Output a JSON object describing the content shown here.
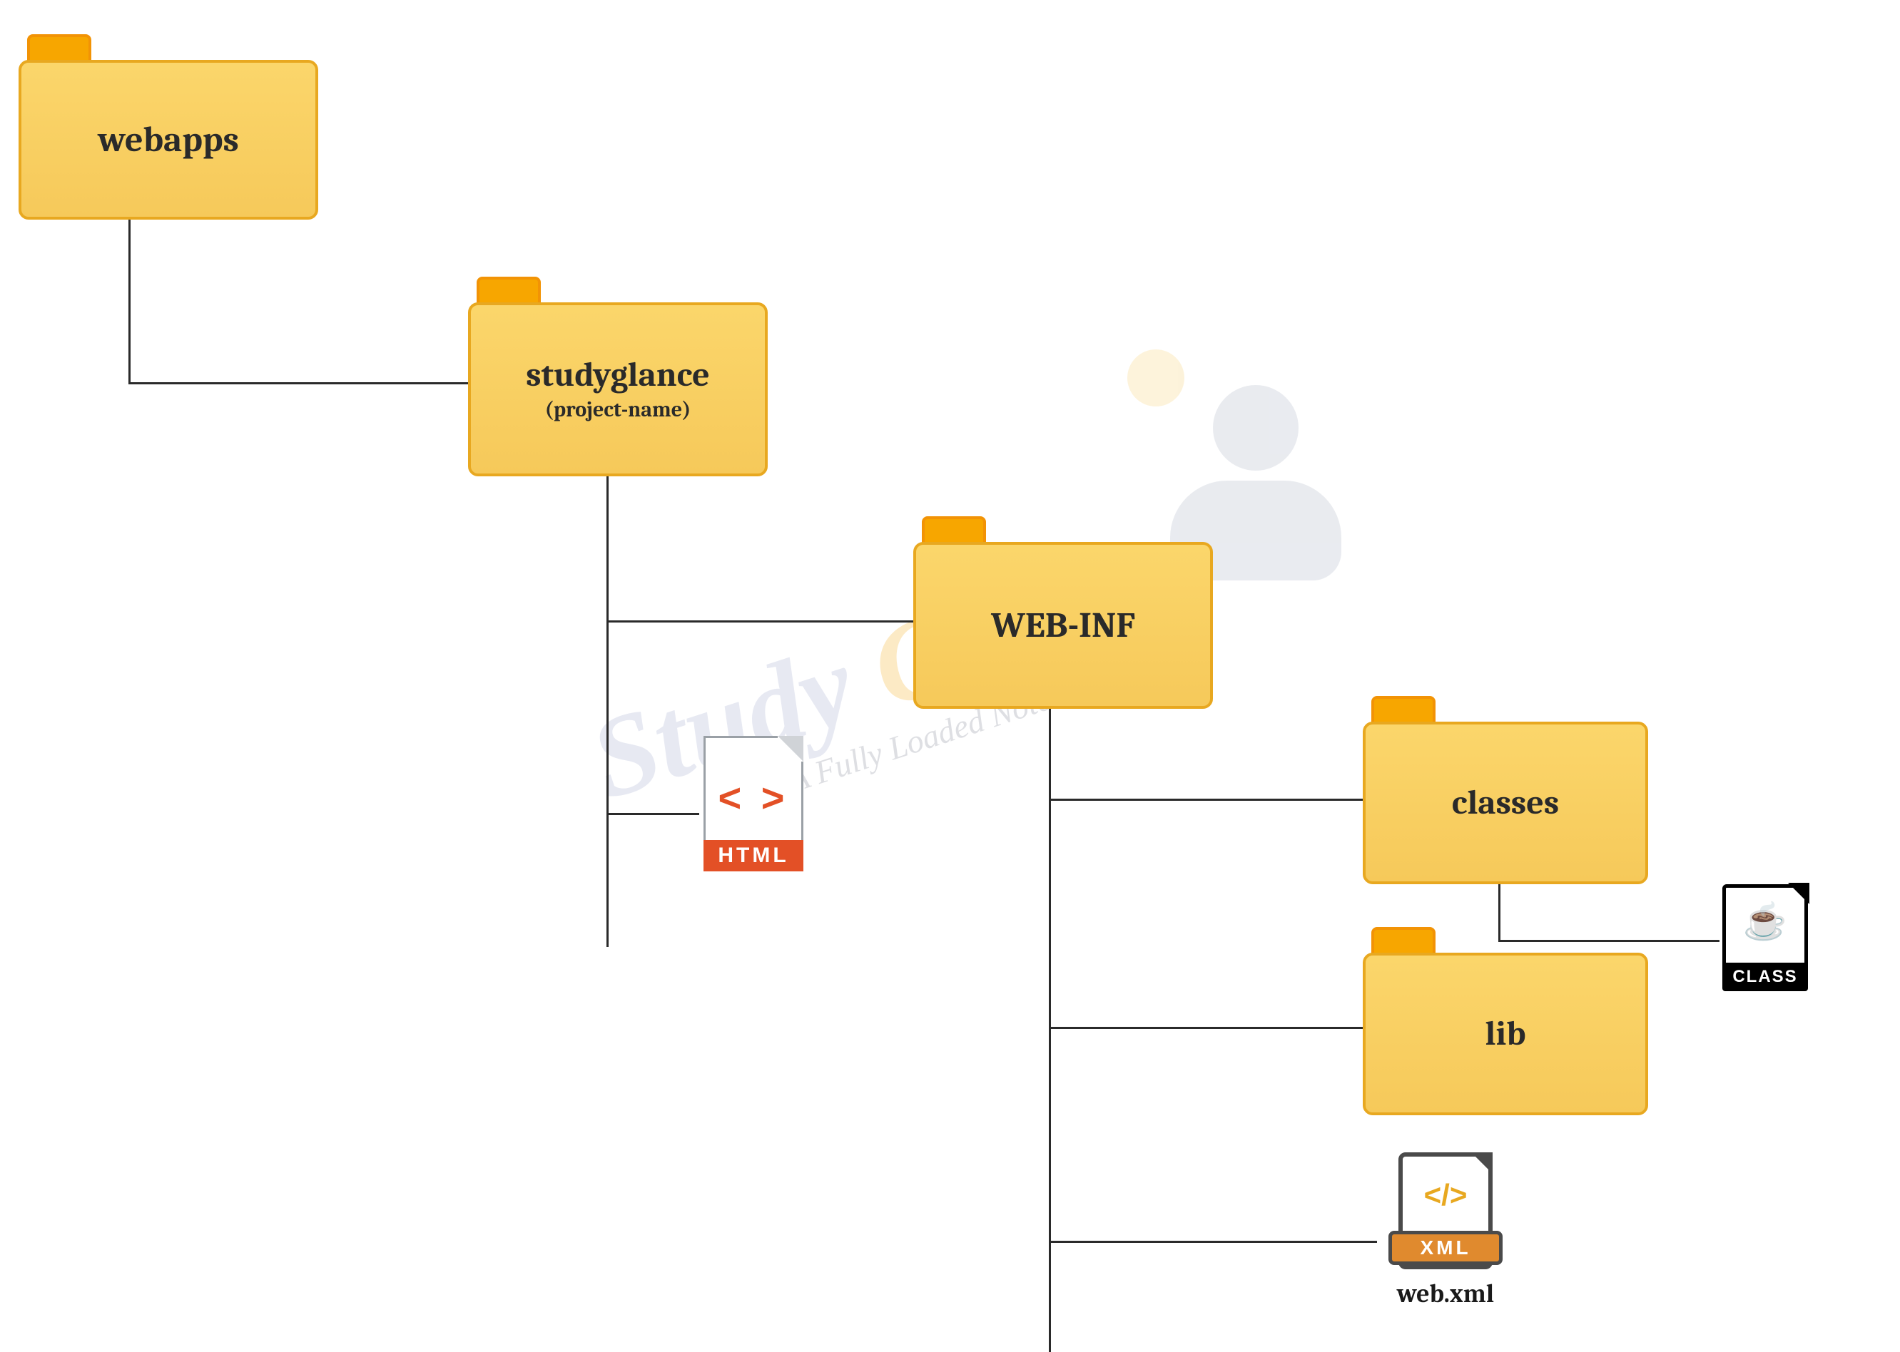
{
  "watermark": {
    "brand_part1": "Study ",
    "brand_part2": "Glance",
    "tagline": "A Fully Loaded Notebook"
  },
  "tree": {
    "root": {
      "label": "webapps"
    },
    "project": {
      "label": "studyglance",
      "subtitle": "(project-name)"
    },
    "webinf": {
      "label": "WEB-INF"
    },
    "classes": {
      "label": "classes"
    },
    "lib": {
      "label": "lib"
    },
    "html_file": {
      "badge": "HTML",
      "glyph": "< >"
    },
    "class_file": {
      "badge": "CLASS",
      "glyph": "☕"
    },
    "xml_file": {
      "badge": "XML",
      "code": "</>",
      "caption": "web.xml"
    }
  }
}
